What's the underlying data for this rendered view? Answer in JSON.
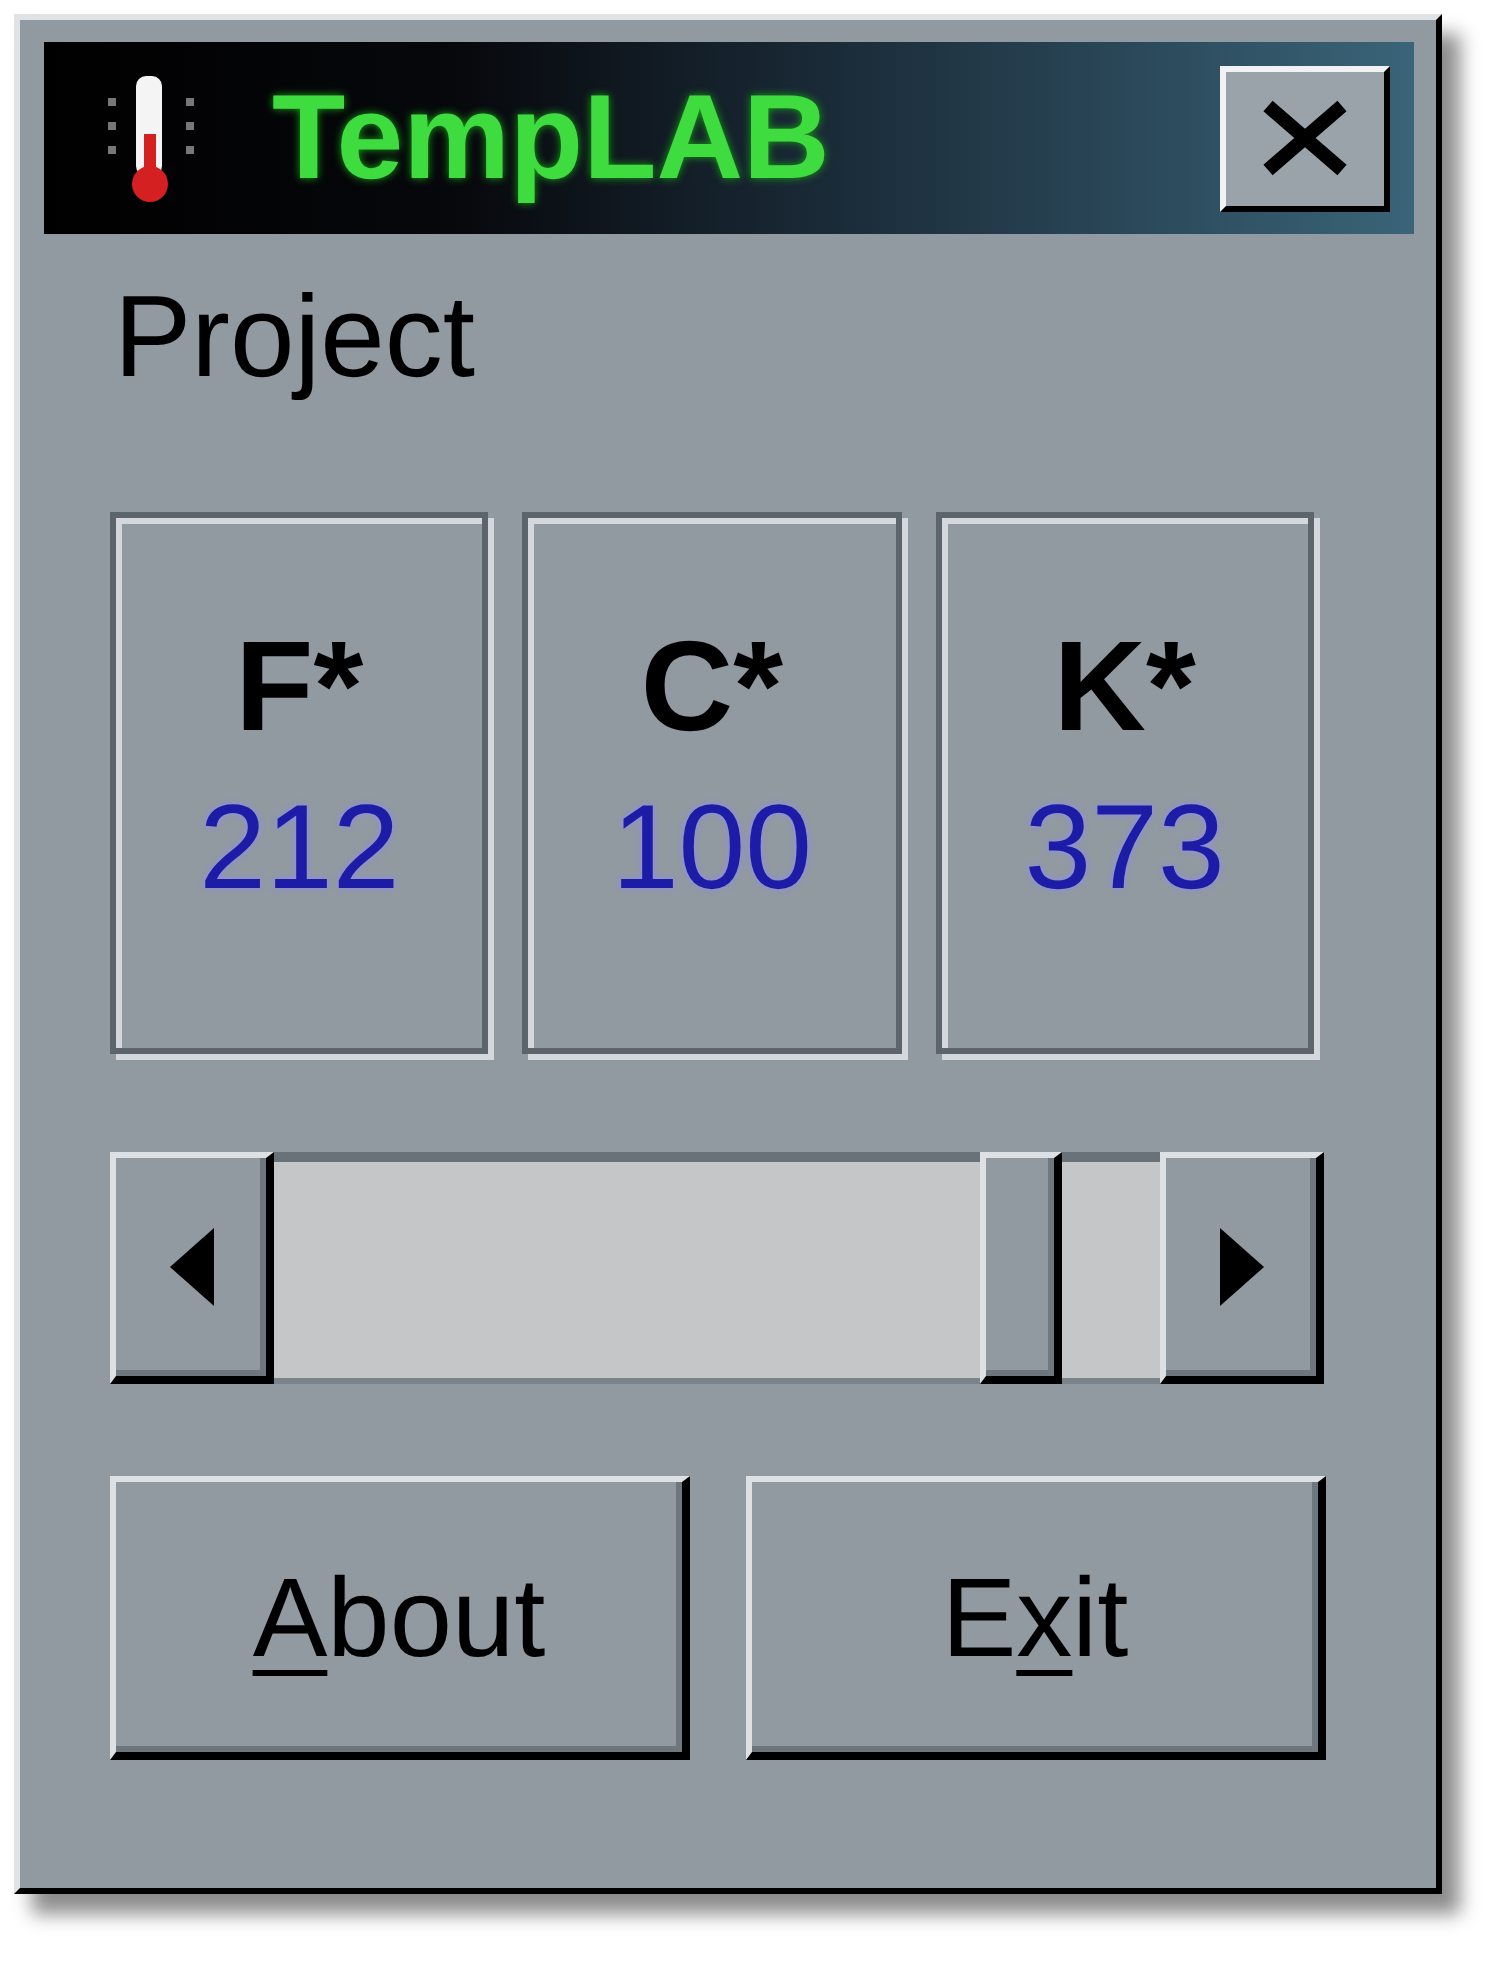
{
  "window": {
    "title": "TempLAB"
  },
  "section_label": "Project",
  "readouts": [
    {
      "unit": "F*",
      "value": "212"
    },
    {
      "unit": "C*",
      "value": "100"
    },
    {
      "unit": "K*",
      "value": "373"
    }
  ],
  "scrollbar": {
    "level": 0.88
  },
  "buttons": [
    {
      "label": [
        {
          "text": "A",
          "underlined": true
        },
        {
          "text": "bout",
          "underlined": false
        }
      ]
    },
    {
      "label": [
        {
          "text": "E",
          "underlined": false
        },
        {
          "text": "x",
          "underlined": true
        },
        {
          "text": "it",
          "underlined": false
        }
      ]
    }
  ]
}
